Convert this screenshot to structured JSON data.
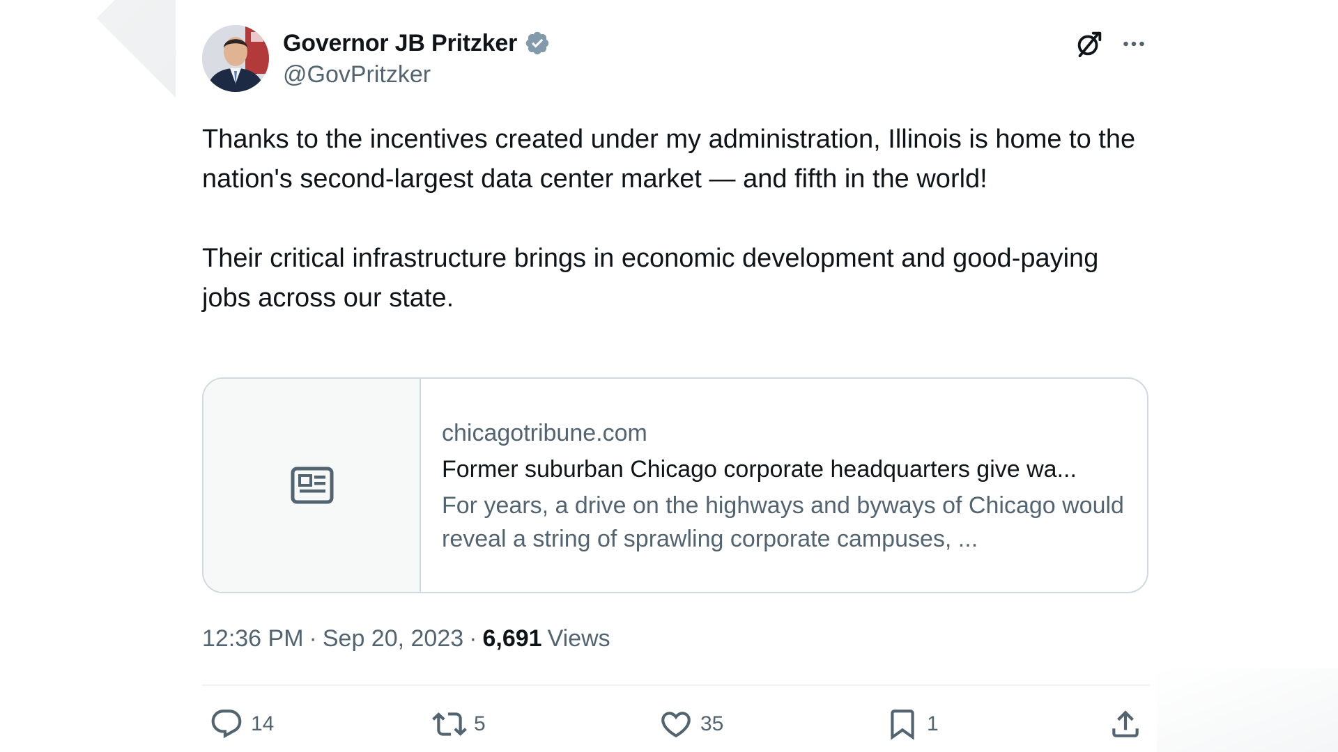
{
  "author": {
    "display_name": "Governor JB Pritzker",
    "handle": "@GovPritzker",
    "verified": true,
    "verified_color": "#829aab"
  },
  "tweet": {
    "paragraphs": [
      "Thanks to the incentives created under my administration, Illinois is home to the nation's second-largest data center market — and fifth in the world!",
      "Their critical infrastructure brings in economic development and good-paying jobs across our state."
    ]
  },
  "link_card": {
    "domain": "chicagotribune.com",
    "title": "Former suburban Chicago corporate headquarters give wa...",
    "description": "For years, a drive on the highways and byways of Chicago would reveal a string of sprawling corporate campuses, ...",
    "thumbnail_icon": "news-article-icon"
  },
  "meta": {
    "time": "12:36 PM",
    "separator": "·",
    "date": "Sep 20, 2023",
    "views_count": "6,691",
    "views_label": "Views"
  },
  "actions": {
    "reply_count": "14",
    "repost_count": "5",
    "like_count": "35",
    "bookmark_count": "1"
  },
  "icons": {
    "grok": "grok-icon",
    "more": "more-options-icon",
    "reply": "reply-icon",
    "repost": "repost-icon",
    "like": "heart-icon",
    "bookmark": "bookmark-icon",
    "share": "share-icon"
  },
  "colors": {
    "text_primary": "#0f1419",
    "text_secondary": "#536471",
    "border": "#cfd9de"
  }
}
